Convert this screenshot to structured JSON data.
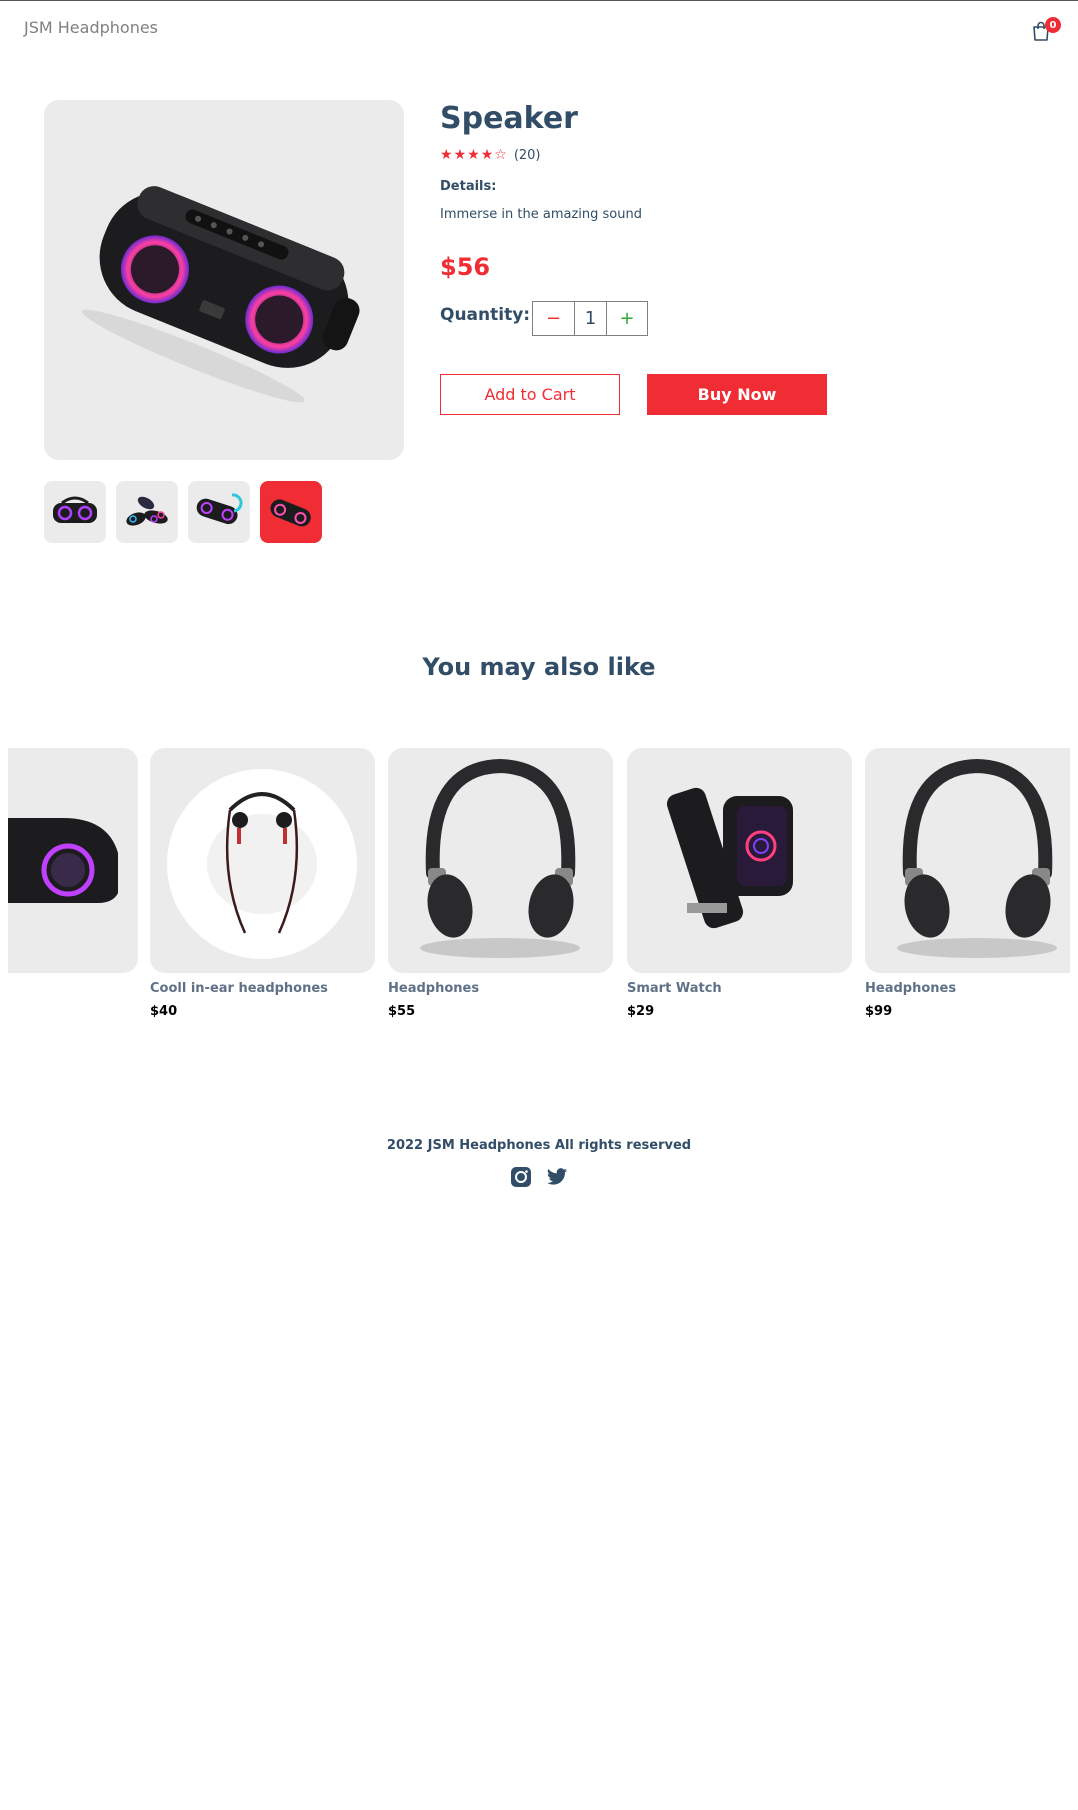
{
  "navbar": {
    "logo": "JSM Headphones",
    "cart_icon": "shopping-bag-icon",
    "cart_count": "0"
  },
  "product": {
    "name": "Speaker",
    "rating": {
      "stars": 4,
      "max": 5,
      "count_label": "(20)"
    },
    "details_label": "Details:",
    "details": "Immerse in the amazing sound",
    "price": "$56",
    "quantity_label": "Quantity:",
    "quantity": "1",
    "minus_icon": "−",
    "plus_icon": "+",
    "add_to_cart": "Add to Cart",
    "buy_now": "Buy Now",
    "thumbnails_count": 4,
    "selected_thumbnail": 4
  },
  "related": {
    "title": "You may also like",
    "items": [
      {
        "name": "",
        "price": ""
      },
      {
        "name": "Cooll in-ear headphones",
        "price": "$40"
      },
      {
        "name": "Headphones",
        "price": "$55"
      },
      {
        "name": "Smart Watch",
        "price": "$29"
      },
      {
        "name": "Headphones",
        "price": "$99"
      }
    ]
  },
  "footer": {
    "text": "2022 JSM Headphones All rights reserved",
    "socials": [
      "instagram-icon",
      "twitter-icon"
    ]
  },
  "colors": {
    "accent": "#f02d34",
    "text": "#324d67",
    "panel": "#ebebeb",
    "plus": "#31a831"
  }
}
